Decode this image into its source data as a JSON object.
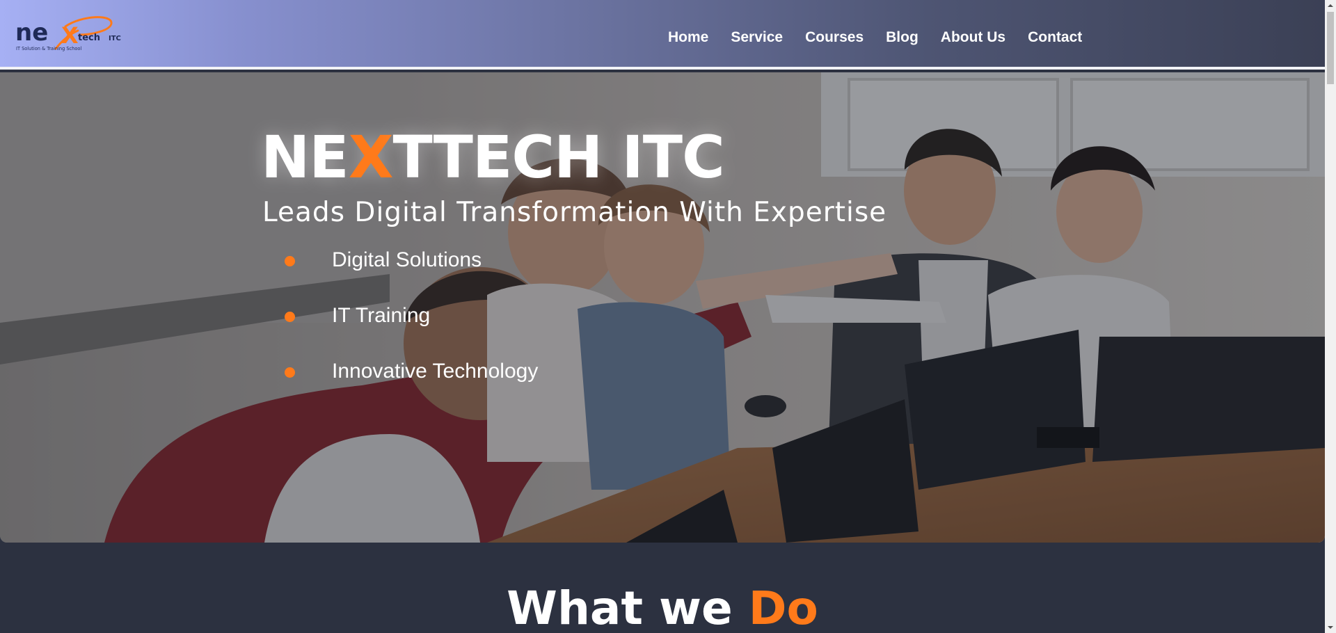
{
  "brand": {
    "logo_main": "ne",
    "logo_x": "X",
    "logo_small": "tech",
    "logo_itc": "ITC",
    "logo_tagline": "IT Solution & Training School",
    "accent_color": "#ff7a1a",
    "dark_color": "#1f2a57"
  },
  "nav": {
    "items": [
      {
        "label": "Home"
      },
      {
        "label": "Service"
      },
      {
        "label": "Courses"
      },
      {
        "label": "Blog"
      },
      {
        "label": "About Us"
      },
      {
        "label": "Contact"
      }
    ]
  },
  "hero": {
    "title_part1": "NE",
    "title_accent": "X",
    "title_part2": "TTECH ITC",
    "subtitle": "Leads Digital Transformation With Expertise",
    "features": [
      {
        "label": "Digital Solutions"
      },
      {
        "label": "IT Training"
      },
      {
        "label": "Innovative Technology"
      }
    ],
    "bullet_color": "#ff7a1a"
  },
  "section": {
    "title_main": "What we",
    "title_accent": "Do"
  },
  "icons": {
    "scroll_up": "scroll-up-arrow-icon",
    "scroll_down": "scroll-down-arrow-icon"
  }
}
